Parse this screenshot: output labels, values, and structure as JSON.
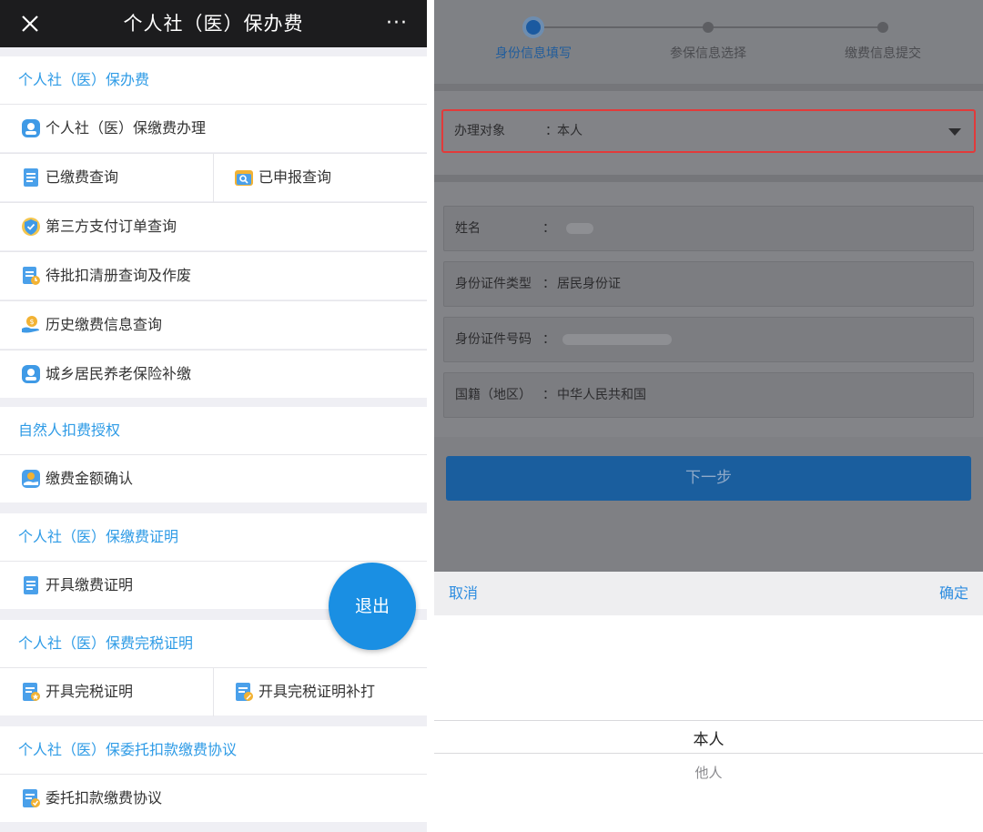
{
  "left": {
    "topbar": {
      "title": "个人社（医）保办费",
      "more": "···"
    },
    "sections": [
      {
        "header": "个人社（医）保办费",
        "rows": [
          [
            {
              "label": "个人社（医）保缴费办理",
              "icon": "social-insurance-icon"
            }
          ],
          [
            {
              "label": "已缴费查询",
              "icon": "document-list-icon"
            },
            {
              "label": "已申报查询",
              "icon": "search-folder-icon"
            }
          ],
          [
            {
              "label": "第三方支付订单查询",
              "icon": "shield-payment-icon"
            }
          ],
          [
            {
              "label": "待批扣清册查询及作废",
              "icon": "pending-list-icon"
            }
          ],
          [
            {
              "label": "历史缴费信息查询",
              "icon": "coin-hand-icon"
            }
          ],
          [
            {
              "label": "城乡居民养老保险补缴",
              "icon": "pension-icon"
            }
          ]
        ]
      },
      {
        "header": "自然人扣费授权",
        "rows": [
          [
            {
              "label": "缴费金额确认",
              "icon": "amount-confirm-icon"
            }
          ]
        ]
      },
      {
        "header": "个人社（医）保缴费证明",
        "rows": [
          [
            {
              "label": "开具缴费证明",
              "icon": "certificate-icon"
            }
          ]
        ]
      },
      {
        "header": "个人社（医）保费完税证明",
        "rows": [
          [
            {
              "label": "开具完税证明",
              "icon": "tax-certificate-icon"
            },
            {
              "label": "开具完税证明补打",
              "icon": "reprint-certificate-icon"
            }
          ]
        ]
      },
      {
        "header": "个人社（医）保委托扣款缴费协议",
        "rows": [
          [
            {
              "label": "委托扣款缴费协议",
              "icon": "agreement-icon"
            }
          ]
        ]
      }
    ],
    "exit_button": "退出"
  },
  "right": {
    "steps": [
      {
        "label": "身份信息填写",
        "active": true
      },
      {
        "label": "参保信息选择",
        "active": false
      },
      {
        "label": "缴费信息提交",
        "active": false
      }
    ],
    "handler": {
      "label": "办理对象",
      "colon": "：",
      "value": "本人"
    },
    "fields": [
      {
        "label": "姓名",
        "colon": "：",
        "value": "",
        "masked": true
      },
      {
        "label": "身份证件类型",
        "colon": "：",
        "value": "居民身份证",
        "masked": false
      },
      {
        "label": "身份证件号码",
        "colon": "：",
        "value": "",
        "masked": true
      },
      {
        "label": "国籍（地区）",
        "colon": "：",
        "value": "中华人民共和国",
        "masked": false
      }
    ],
    "next_button": "下一步",
    "picker": {
      "cancel": "取消",
      "confirm": "确定",
      "options": [
        "本人",
        "他人"
      ],
      "selected": "本人"
    }
  },
  "colors": {
    "accent_blue": "#2e9be6",
    "exit_blue": "#1a8fe3",
    "highlight_red": "#e23a3a",
    "topbar": "#1c1c1e"
  }
}
